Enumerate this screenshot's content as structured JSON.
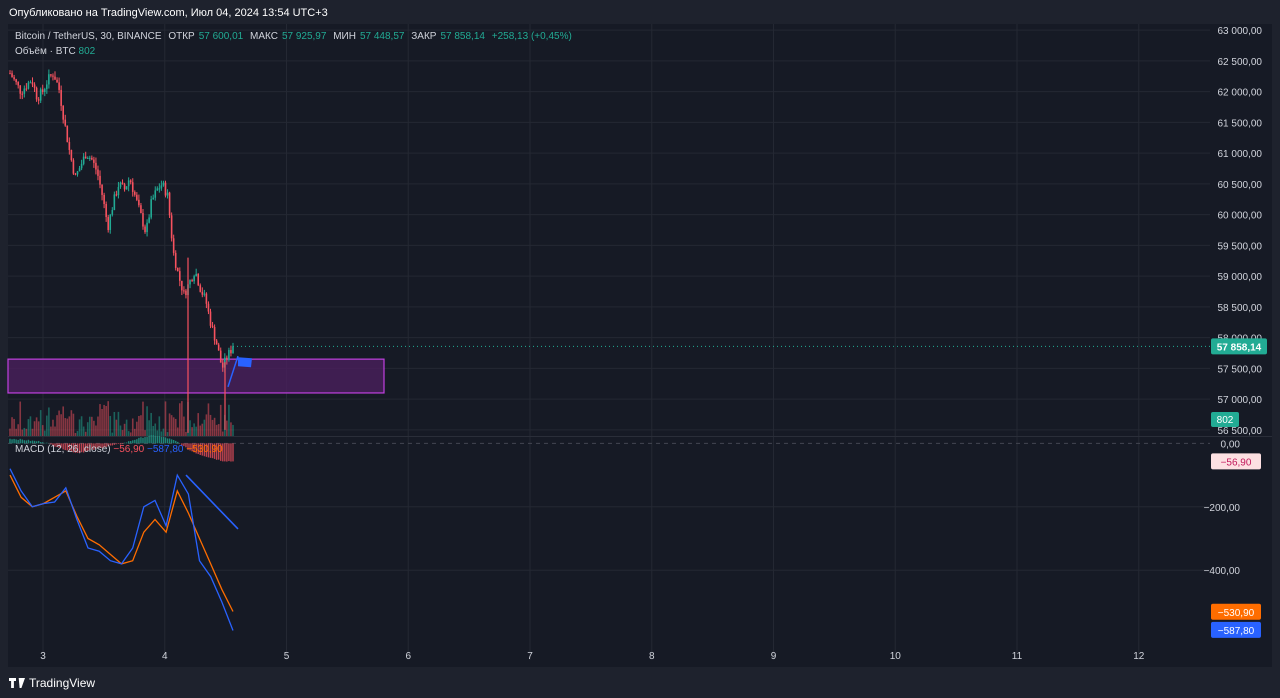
{
  "published": "Опубликовано на TradingView.com, Июл 04, 2024 13:54 UTC+3",
  "brand": "TradingView",
  "legend": {
    "symbol": "Bitcoin / TetherUS, 30, BINANCE",
    "open_label": "ОТКР",
    "open": "57 600,01",
    "high_label": "МАКС",
    "high": "57 925,97",
    "low_label": "МИН",
    "low": "57 448,57",
    "close_label": "ЗАКР",
    "close": "57 858,14",
    "change": "+258,13 (+0,45%)"
  },
  "volume_legend": {
    "label": "Объём · BTC",
    "value": "802"
  },
  "macd_legend": {
    "label": "MACD (12, 26, close)",
    "hist": "−56,90",
    "macd": "−587,80",
    "signal": "−530,90"
  },
  "colors": {
    "up": "#22ab94",
    "down": "#f7525f",
    "macd": "#2962ff",
    "signal": "#ff6d00",
    "zone_border": "#9c27b0",
    "zone_fill": "#4a1f5c",
    "background": "#161a25"
  },
  "chart_data": [
    {
      "type": "candlestick",
      "title": "Bitcoin / TetherUS, 30, BINANCE",
      "y_ticks": [
        "63 000,00",
        "62 500,00",
        "62 000,00",
        "61 500,00",
        "61 000,00",
        "60 500,00",
        "60 000,00",
        "59 500,00",
        "59 000,00",
        "58 500,00",
        "58 000,00",
        "57 500,00",
        "57 000,00",
        "56 500,00"
      ],
      "ylim": [
        56400,
        63100
      ],
      "x_ticks": [
        "3",
        "4",
        "5",
        "6",
        "7",
        "8",
        "9",
        "10",
        "11",
        "12"
      ],
      "last_price_label": "57 858,14",
      "volume_label": "802",
      "price_path": [
        62300,
        62150,
        62000,
        62100,
        62200,
        61900,
        62000,
        62200,
        62300,
        62050,
        61500,
        61000,
        60600,
        60800,
        61000,
        60900,
        60700,
        60300,
        59800,
        60200,
        60500,
        60400,
        60600,
        60300,
        60000,
        59700,
        60200,
        60400,
        60500,
        60300,
        59400,
        59000,
        58700,
        58900,
        59100,
        58800,
        58600,
        58200,
        57900,
        57500,
        57700,
        57858
      ],
      "resistance_zone": [
        57100,
        57650
      ],
      "grid": true
    },
    {
      "type": "line",
      "title": "MACD (12, 26, close)",
      "y_ticks": [
        "0,00",
        "−200,00",
        "−400,00"
      ],
      "ylim": [
        -620,
        20
      ],
      "macd_label": "−587,80",
      "signal_label": "−530,90",
      "hist_label": "−56,90",
      "macd_path": [
        -80,
        -150,
        -200,
        -190,
        -185,
        -140,
        -240,
        -330,
        -340,
        -370,
        -380,
        -330,
        -200,
        -180,
        -260,
        -100,
        -160,
        -370,
        -420,
        -500,
        -590
      ],
      "signal_path": [
        -100,
        -170,
        -200,
        -190,
        -170,
        -150,
        -230,
        -300,
        -320,
        -350,
        -380,
        -370,
        -280,
        -240,
        -280,
        -150,
        -220,
        -300,
        -380,
        -460,
        -530
      ],
      "hist_path": [
        15,
        12,
        8,
        5,
        -8,
        -20,
        -30,
        -25,
        -15,
        -8,
        -2,
        10,
        20,
        25,
        18,
        5,
        -20,
        -35,
        -45,
        -55,
        -57
      ]
    }
  ]
}
